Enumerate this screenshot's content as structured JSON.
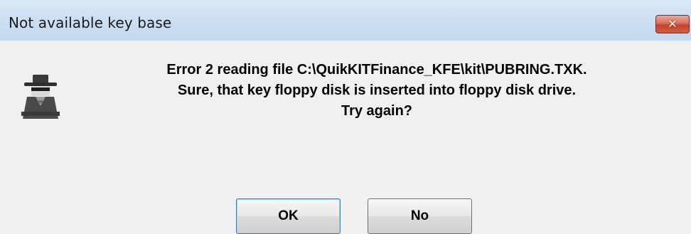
{
  "window": {
    "title": "Not available key base",
    "close_glyph": "✕",
    "titlebar_color": "#cddff3",
    "close_color": "#c9513a"
  },
  "dialog": {
    "icon": "secret-agent-icon",
    "message_lines": [
      "Error 2 reading file C:\\QuikKITFinance_KFE\\kit\\PUBRING.TXK.",
      "Sure, that key floppy disk is inserted into floppy disk drive.",
      "Try again?"
    ]
  },
  "buttons": {
    "ok_label": "OK",
    "no_label": "No"
  }
}
